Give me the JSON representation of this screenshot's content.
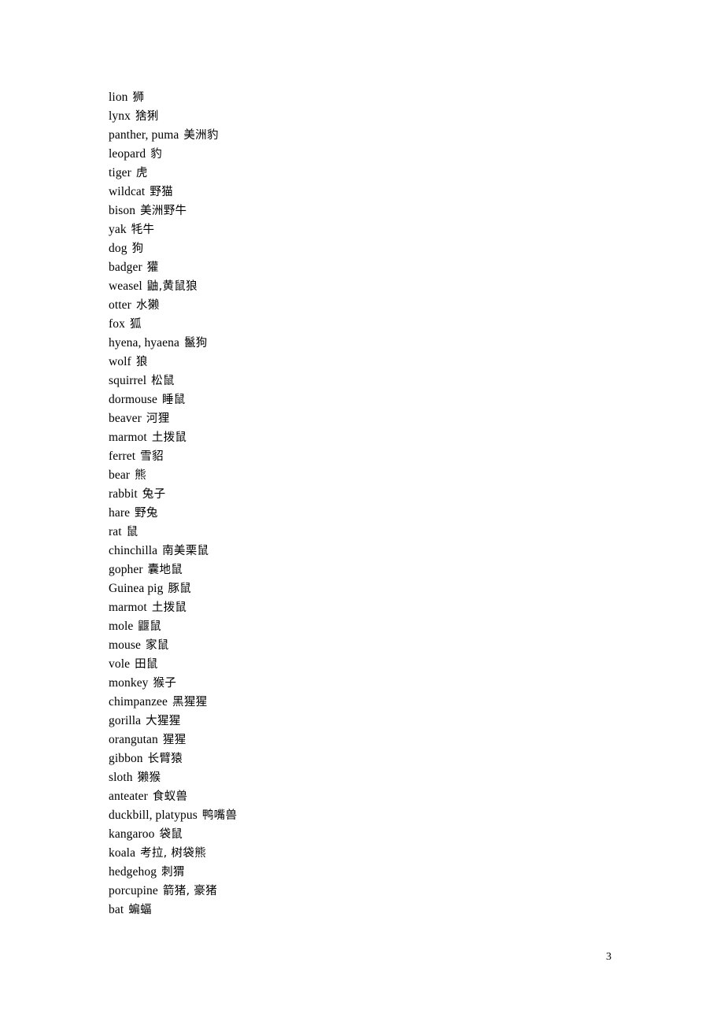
{
  "document": {
    "page_number": "3",
    "background_color": "#ffffff",
    "text_color": "#000000"
  },
  "vocab_list": [
    {
      "term": "lion",
      "gloss": "狮"
    },
    {
      "term": "lynx",
      "gloss": "猞猁"
    },
    {
      "term": "panther, puma",
      "gloss": "美洲豹"
    },
    {
      "term": "leopard",
      "gloss": "豹"
    },
    {
      "term": "tiger",
      "gloss": "虎"
    },
    {
      "term": "wildcat",
      "gloss": "野猫"
    },
    {
      "term": "bison",
      "gloss": "美洲野牛"
    },
    {
      "term": "yak",
      "gloss": "牦牛"
    },
    {
      "term": "dog",
      "gloss": "狗"
    },
    {
      "term": "badger",
      "gloss": "獾"
    },
    {
      "term": "weasel",
      "gloss": "鼬,黄鼠狼"
    },
    {
      "term": "otter",
      "gloss": "水獭"
    },
    {
      "term": "fox",
      "gloss": "狐"
    },
    {
      "term": "hyena, hyaena",
      "gloss": "鬣狗"
    },
    {
      "term": "wolf",
      "gloss": "狼"
    },
    {
      "term": "squirrel",
      "gloss": "松鼠"
    },
    {
      "term": "dormouse",
      "gloss": "睡鼠"
    },
    {
      "term": "beaver",
      "gloss": "河狸"
    },
    {
      "term": "marmot",
      "gloss": "土拨鼠"
    },
    {
      "term": "ferret",
      "gloss": "雪貂"
    },
    {
      "term": "bear",
      "gloss": "熊"
    },
    {
      "term": "rabbit",
      "gloss": "兔子"
    },
    {
      "term": "hare",
      "gloss": "野兔"
    },
    {
      "term": "rat",
      "gloss": "鼠"
    },
    {
      "term": "chinchilla",
      "gloss": "南美栗鼠"
    },
    {
      "term": "gopher",
      "gloss": "囊地鼠"
    },
    {
      "term": "Guinea pig",
      "gloss": "豚鼠"
    },
    {
      "term": "marmot",
      "gloss": "土拨鼠"
    },
    {
      "term": "mole",
      "gloss": "鼴鼠"
    },
    {
      "term": "mouse",
      "gloss": "家鼠"
    },
    {
      "term": "vole",
      "gloss": "田鼠"
    },
    {
      "term": "monkey",
      "gloss": "猴子"
    },
    {
      "term": "chimpanzee",
      "gloss": "黑猩猩"
    },
    {
      "term": "gorilla",
      "gloss": "大猩猩"
    },
    {
      "term": "orangutan",
      "gloss": "猩猩"
    },
    {
      "term": "gibbon",
      "gloss": "长臂猿"
    },
    {
      "term": "sloth",
      "gloss": "獭猴"
    },
    {
      "term": "anteater",
      "gloss": "食蚁兽"
    },
    {
      "term": "duckbill, platypus",
      "gloss": "鸭嘴兽"
    },
    {
      "term": "kangaroo",
      "gloss": "袋鼠"
    },
    {
      "term": "koala",
      "gloss": "考拉, 树袋熊"
    },
    {
      "term": "hedgehog",
      "gloss": "刺猬"
    },
    {
      "term": "porcupine",
      "gloss": "箭猪, 豪猪"
    },
    {
      "term": "bat",
      "gloss": "蝙蝠"
    }
  ]
}
